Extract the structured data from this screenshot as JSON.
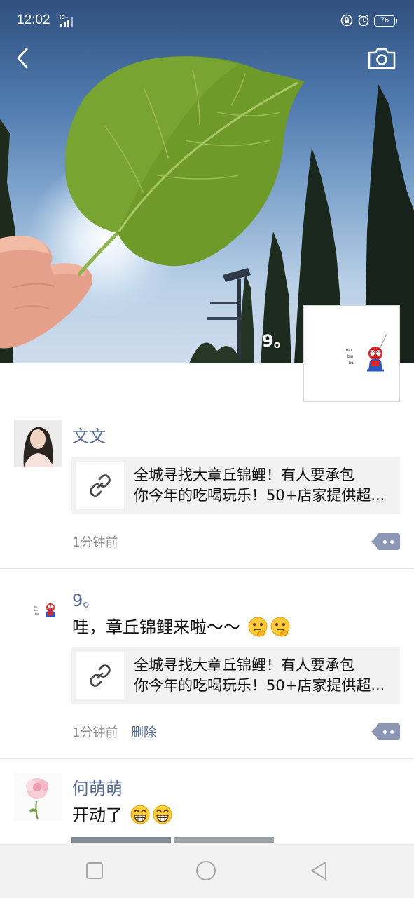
{
  "status_bar": {
    "time": "12:02",
    "network": "4G+",
    "battery": "76",
    "icons": [
      "rotation-lock-icon",
      "alarm-icon",
      "battery-icon"
    ]
  },
  "header": {
    "back_icon": "chevron-left-icon",
    "camera_icon": "camera-icon",
    "owner_name": "9。"
  },
  "posts": [
    {
      "name": "文文",
      "text": "",
      "link": {
        "icon": "link-icon",
        "title_line1": "全城寻找大章丘锦鲤！有人要承包",
        "title_line2": "你今年的吃喝玩乐！50+店家提供超..."
      },
      "time": "1分钟前",
      "delete_label": ""
    },
    {
      "name": "9。",
      "text": "哇，章丘锦鲤来啦～～",
      "link": {
        "icon": "link-icon",
        "title_line1": "全城寻找大章丘锦鲤！有人要承包",
        "title_line2": "你今年的吃喝玩乐！50+店家提供超..."
      },
      "time": "1分钟前",
      "delete_label": "删除"
    },
    {
      "name": "何萌萌",
      "text": "开动了"
    }
  ],
  "avatar_sticker_text": [
    "biu",
    "biu",
    "biu"
  ],
  "navbar": {
    "icons": [
      "recent-apps-icon",
      "home-icon",
      "back-icon"
    ]
  },
  "colors": {
    "name_link": "#576b95",
    "more_button": "#8b97b4",
    "link_card_bg": "#f2f2f2",
    "time_gray": "#8a8a8a"
  }
}
